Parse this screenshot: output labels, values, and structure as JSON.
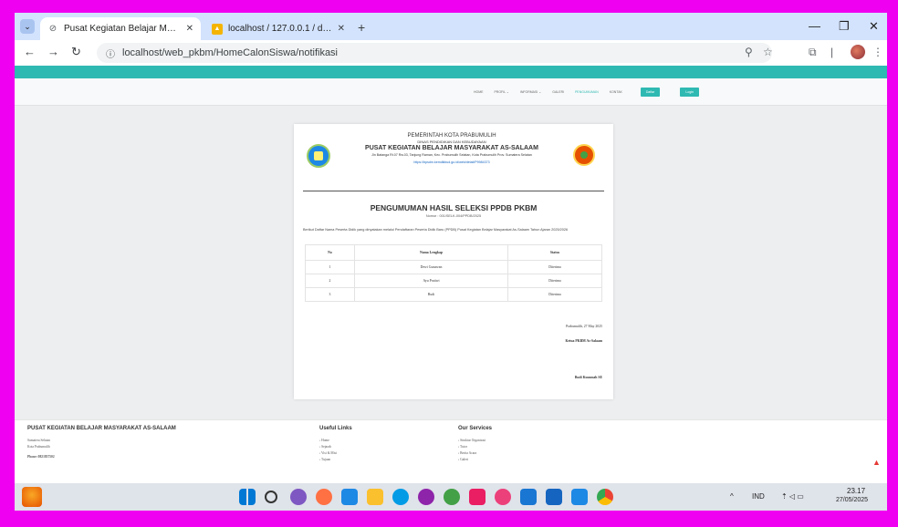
{
  "browser": {
    "tabs": [
      {
        "title": "Pusat Kegiatan Belajar Masyara",
        "close": "✕"
      },
      {
        "title": "localhost / 127.0.0.1 / db_pkbm",
        "close": "✕"
      }
    ],
    "new_tab": "+",
    "url": "localhost/web_pkbm/HomeCalonSiswa/notifikasi",
    "window_controls": {
      "minimize": "—",
      "maximize": "❐",
      "close": "✕"
    }
  },
  "navbar": {
    "items": [
      "HOME",
      "PROFIL ⌄",
      "INFORMASI ⌄",
      "GALERI",
      "PENGUMUMAN",
      "KONTAK"
    ],
    "active_index": 4,
    "buttons": [
      "Daftar",
      "Login"
    ],
    "accent_color": "#2fb9b3"
  },
  "document": {
    "kop": {
      "line1": "PEMERINTAH KOTA PRABUMULIH",
      "line2": "DINAS PENDIDIKAN DAN KEBUDAYAAN",
      "line3": "PUSAT KEGIATAN BELAJAR MASYARAKAT AS-SALAAM",
      "address": "Jln Batanga Rt.07 Rw.03, Tanjung Raman, Kec. Prabumulih Selatan, Kota Prabumulih Prov. Sumatera Selatan",
      "link": "https://bpsdm.kemdikbud.go.id/web/detail/P9984373"
    },
    "title": "PENGUMUMAN HASIL SELEKSI PPDB PKBM",
    "number": "Nomor : 001/SELK-004/PPDB/2025",
    "intro": "Berikut Daftar Nama Peserta Didik yang dinyatakan melalui Pendaftaran Peserta Didik Baru (PPDB) Pusat Kegiatan Belajar Masyarakat As-Salaam Tahun Ajaran 2025/2026",
    "table": {
      "headers": [
        "No",
        "Nama Lengkap",
        "Status"
      ],
      "rows": [
        [
          "1",
          "Dewi Gunawan",
          "Diterima"
        ],
        [
          "2",
          "Ayu Pratiwi",
          "Diterima"
        ],
        [
          "3",
          "Budi",
          "Diterima"
        ]
      ]
    },
    "signature": {
      "place_date": "Prabumulih, 27 May 2025",
      "title": "Ketua PKBM As-Salaam",
      "name": "Budi Kusumah SE"
    }
  },
  "footer": {
    "org_title": "PUSAT KEGIATAN BELAJAR MASYARAKAT AS-SALAAM",
    "org_lines": [
      "Sumatera Selatan",
      "Kota Prabumulih",
      "Phone: 0821837502"
    ],
    "useful_links_title": "Useful Links",
    "useful_links": [
      "› Home",
      "› Sejarah",
      "› Visi & Misi",
      "› Tujuan"
    ],
    "services_title": "Our Services",
    "services": [
      "› Struktur Organisasi",
      "› Tutor",
      "› Berita Acara",
      "› Galeri"
    ]
  },
  "taskbar": {
    "language": "IND",
    "time": "23.17",
    "date": "27/05/2025",
    "tray_chevron": "^",
    "tray_icons": "⇡ ◁ ▭"
  }
}
